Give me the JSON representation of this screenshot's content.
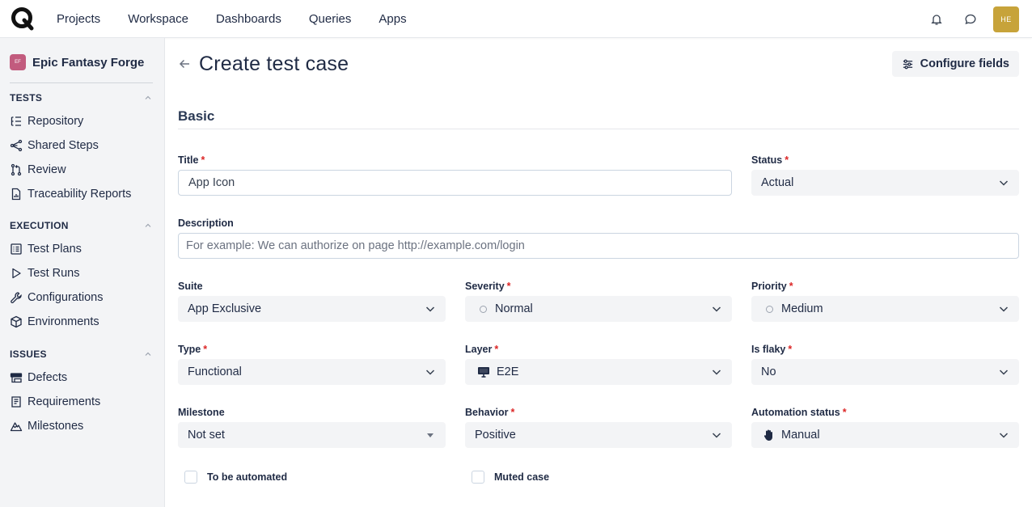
{
  "nav": {
    "items": [
      "Projects",
      "Workspace",
      "Dashboards",
      "Queries",
      "Apps"
    ]
  },
  "user": {
    "initials": "HE"
  },
  "project": {
    "badge": "EF",
    "name": "Epic Fantasy Forge"
  },
  "sidebar": {
    "sections": [
      {
        "title": "TESTS",
        "items": [
          "Repository",
          "Shared Steps",
          "Review",
          "Traceability Reports"
        ]
      },
      {
        "title": "EXECUTION",
        "items": [
          "Test Plans",
          "Test Runs",
          "Configurations",
          "Environments"
        ]
      },
      {
        "title": "ISSUES",
        "items": [
          "Defects",
          "Requirements",
          "Milestones"
        ]
      }
    ]
  },
  "page": {
    "title": "Create test case",
    "configure_label": "Configure fields",
    "section_basic": "Basic"
  },
  "form": {
    "title": {
      "label": "Title",
      "value": "App Icon"
    },
    "status": {
      "label": "Status",
      "value": "Actual"
    },
    "description": {
      "label": "Description",
      "placeholder": "For example: We can authorize on page http://example.com/login"
    },
    "suite": {
      "label": "Suite",
      "value": "App Exclusive"
    },
    "severity": {
      "label": "Severity",
      "value": "Normal"
    },
    "priority": {
      "label": "Priority",
      "value": "Medium"
    },
    "type": {
      "label": "Type",
      "value": "Functional"
    },
    "layer": {
      "label": "Layer",
      "value": "E2E"
    },
    "is_flaky": {
      "label": "Is flaky",
      "value": "No"
    },
    "milestone": {
      "label": "Milestone",
      "value": "Not set"
    },
    "behavior": {
      "label": "Behavior",
      "value": "Positive"
    },
    "automation_status": {
      "label": "Automation status",
      "value": "Manual"
    },
    "to_be_automated": {
      "label": "To be automated",
      "checked": false
    },
    "muted_case": {
      "label": "Muted case",
      "checked": false
    },
    "required_marker": "*"
  },
  "colors": {
    "accent": "#c7a33a",
    "project_badge": "#c25b7e",
    "required": "#dc2626",
    "select_bg": "#f3f4f6"
  }
}
